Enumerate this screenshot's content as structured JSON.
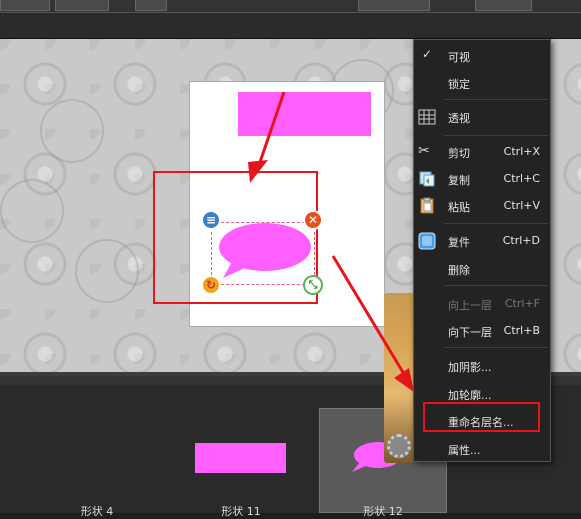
{
  "context_menu": {
    "items": [
      {
        "label": "可视",
        "shortcut": "",
        "icon": "check-icon",
        "checked": true,
        "enabled": true
      },
      {
        "label": "锁定",
        "shortcut": "",
        "icon": "",
        "enabled": true
      },
      {
        "label": "透视",
        "shortcut": "",
        "icon": "perspective-grid-icon",
        "enabled": true
      },
      {
        "label": "剪切",
        "shortcut": "Ctrl+X",
        "icon": "scissors-icon",
        "enabled": true
      },
      {
        "label": "复制",
        "shortcut": "Ctrl+C",
        "icon": "copy-icon",
        "enabled": true
      },
      {
        "label": "粘贴",
        "shortcut": "Ctrl+V",
        "icon": "paste-icon",
        "enabled": true
      },
      {
        "label": "复件",
        "shortcut": "Ctrl+D",
        "icon": "duplicate-icon",
        "enabled": true
      },
      {
        "label": "删除",
        "shortcut": "",
        "icon": "",
        "enabled": true
      },
      {
        "label": "向上一层",
        "shortcut": "Ctrl+F",
        "icon": "",
        "enabled": false
      },
      {
        "label": "向下一层",
        "shortcut": "Ctrl+B",
        "icon": "",
        "enabled": true
      },
      {
        "label": "加阴影...",
        "shortcut": "",
        "icon": "",
        "enabled": true
      },
      {
        "label": "加轮廓...",
        "shortcut": "",
        "icon": "",
        "enabled": true
      },
      {
        "label": "重命名层名...",
        "shortcut": "",
        "icon": "",
        "enabled": true,
        "highlighted": true
      },
      {
        "label": "属性...",
        "shortcut": "",
        "icon": "",
        "enabled": true
      }
    ]
  },
  "filmstrip": {
    "thumbs": [
      {
        "label": "形状 4"
      },
      {
        "label": "形状 11"
      },
      {
        "label": "形状 12",
        "selected": true
      }
    ]
  },
  "colors": {
    "accent_magenta": "#ff5fff",
    "annotation_red": "#e8141c",
    "menu_bg": "#232323"
  }
}
